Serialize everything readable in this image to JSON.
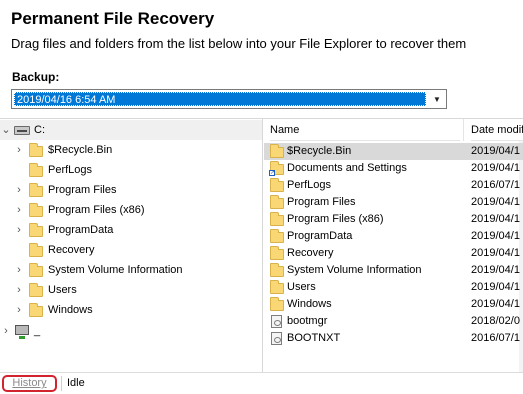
{
  "header": {
    "title": "Permanent File Recovery",
    "subtitle": "Drag files and folders from the list below into your File Explorer to recover them"
  },
  "backup": {
    "label": "Backup:",
    "selected": "2019/04/16 6:54 AM"
  },
  "tree": {
    "drive": {
      "label": "C:",
      "expanded": true,
      "icon": "hard-drive-icon"
    },
    "items": [
      {
        "label": "$Recycle.Bin",
        "expandable": true
      },
      {
        "label": "PerfLogs",
        "expandable": false
      },
      {
        "label": "Program Files",
        "expandable": true
      },
      {
        "label": "Program Files (x86)",
        "expandable": true
      },
      {
        "label": "ProgramData",
        "expandable": true
      },
      {
        "label": "Recovery",
        "expandable": false
      },
      {
        "label": "System Volume Information",
        "expandable": true
      },
      {
        "label": "Users",
        "expandable": true
      },
      {
        "label": "Windows",
        "expandable": true
      }
    ],
    "network": {
      "label": "_",
      "icon": "network-drive-icon"
    }
  },
  "list": {
    "columns": {
      "name": "Name",
      "date": "Date modifi"
    },
    "rows": [
      {
        "name": "$Recycle.Bin",
        "date": "2019/04/1",
        "type": "folder",
        "selected": true
      },
      {
        "name": "Documents and Settings",
        "date": "2019/04/1",
        "type": "shortcut"
      },
      {
        "name": "PerfLogs",
        "date": "2016/07/1",
        "type": "folder"
      },
      {
        "name": "Program Files",
        "date": "2019/04/1",
        "type": "folder"
      },
      {
        "name": "Program Files (x86)",
        "date": "2019/04/1",
        "type": "folder"
      },
      {
        "name": "ProgramData",
        "date": "2019/04/1",
        "type": "folder"
      },
      {
        "name": "Recovery",
        "date": "2019/04/1",
        "type": "folder"
      },
      {
        "name": "System Volume Information",
        "date": "2019/04/1",
        "type": "folder"
      },
      {
        "name": "Users",
        "date": "2019/04/1",
        "type": "folder"
      },
      {
        "name": "Windows",
        "date": "2019/04/1",
        "type": "folder"
      },
      {
        "name": "bootmgr",
        "date": "2018/02/0",
        "type": "file"
      },
      {
        "name": "BOOTNXT",
        "date": "2016/07/1",
        "type": "file"
      }
    ]
  },
  "status": {
    "history_label": "History",
    "text": "Idle"
  },
  "colors": {
    "selection": "#0078d7",
    "folder": "#f8d774",
    "history_outline": "#d1242f"
  }
}
